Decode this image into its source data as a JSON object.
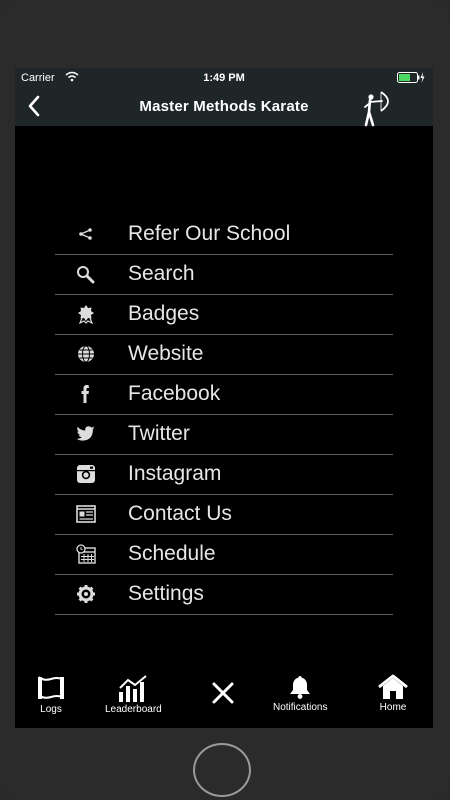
{
  "status_bar": {
    "carrier": "Carrier",
    "time": "1:49 PM",
    "wifi_icon": "wifi-icon",
    "battery_icon": "battery-charging-icon",
    "battery_color": "#4cd964"
  },
  "nav": {
    "title": "Master Methods Karate",
    "back_icon": "chevron-left-icon",
    "logo_icon": "archer-logo-icon"
  },
  "menu": {
    "items": [
      {
        "label": "Refer Our School",
        "icon": "share-icon"
      },
      {
        "label": "Search",
        "icon": "search-icon"
      },
      {
        "label": "Badges",
        "icon": "badge-icon"
      },
      {
        "label": "Website",
        "icon": "globe-icon"
      },
      {
        "label": "Facebook",
        "icon": "facebook-icon"
      },
      {
        "label": "Twitter",
        "icon": "twitter-icon"
      },
      {
        "label": "Instagram",
        "icon": "instagram-icon"
      },
      {
        "label": "Contact Us",
        "icon": "contact-card-icon"
      },
      {
        "label": "Schedule",
        "icon": "calendar-icon"
      },
      {
        "label": "Settings",
        "icon": "gear-icon"
      }
    ]
  },
  "tabbar": {
    "logs": "Logs",
    "leaderboard": "Leaderboard",
    "close_icon": "close-icon",
    "notifications": "Notifications",
    "home": "Home"
  },
  "colors": {
    "background": "#000000",
    "bar": "#1f2628",
    "text": "#e6e6e6",
    "divider": "#5c5c5c"
  }
}
